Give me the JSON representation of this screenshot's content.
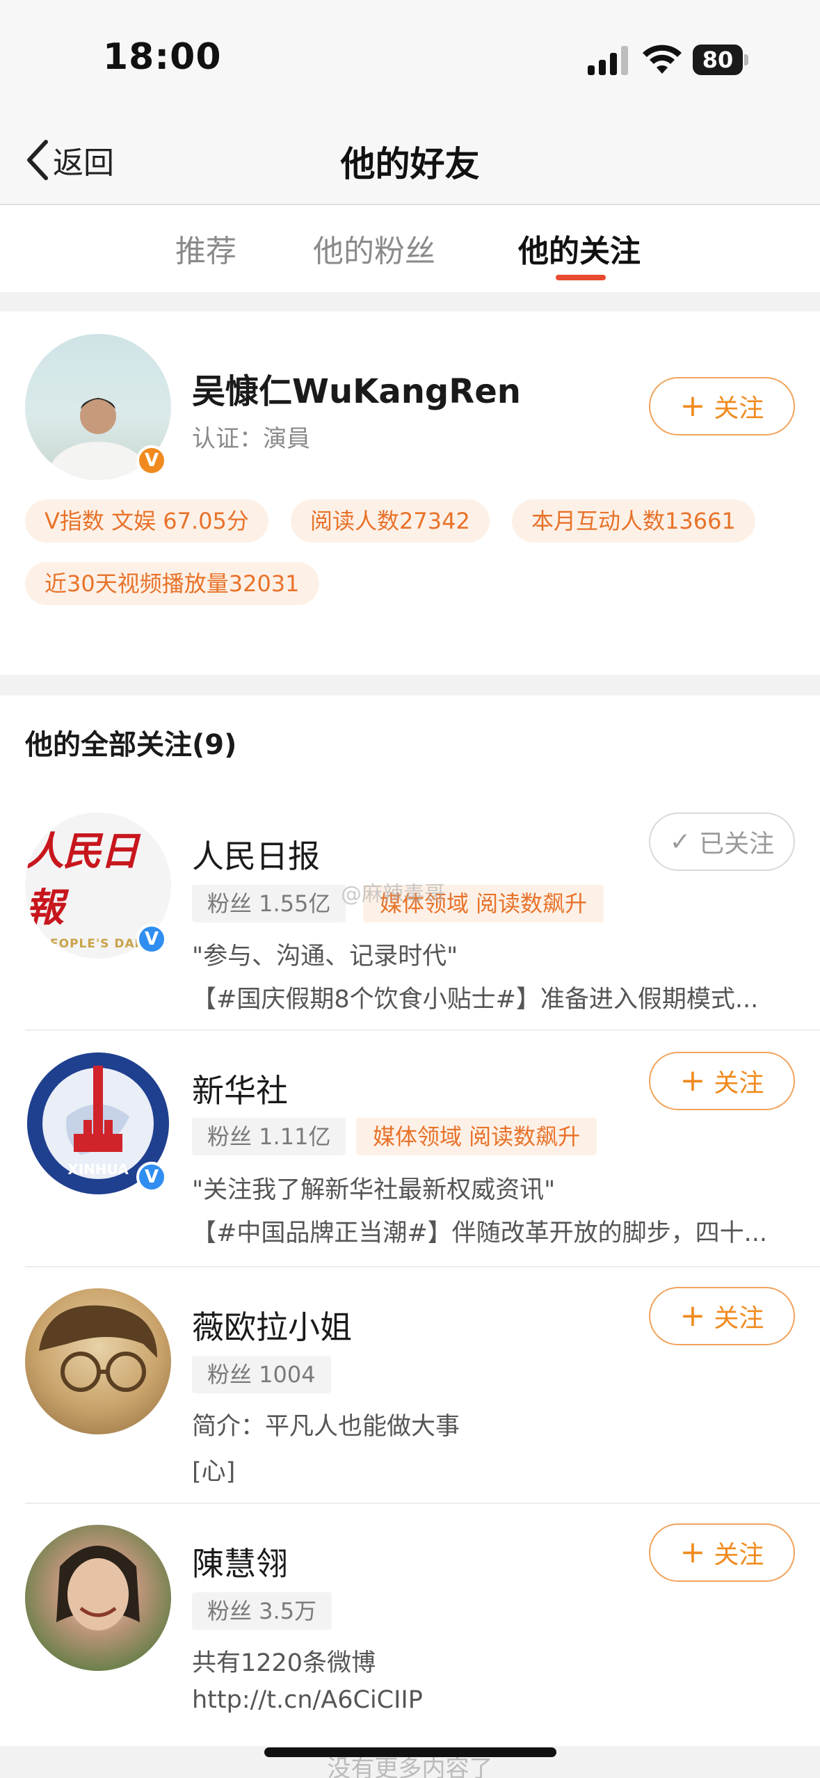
{
  "status_bar": {
    "time": "18:00",
    "battery": "80"
  },
  "nav": {
    "back_label": "返回",
    "title": "他的好友"
  },
  "tabs": [
    {
      "label": "推荐"
    },
    {
      "label": "他的粉丝"
    },
    {
      "label": "他的关注",
      "active": true
    }
  ],
  "profile": {
    "name": "吴慷仁WuKangRen",
    "certification": "认证：演員",
    "follow_label": "关注",
    "badge": "V",
    "chips": [
      "V指数 文娱 67.05分",
      "阅读人数27342",
      "本月互动人数13661",
      "近30天视频播放量32031"
    ]
  },
  "following_section": {
    "title": "他的全部关注(9)"
  },
  "following": [
    {
      "name": "人民日报",
      "fans": "粉丝 1.55亿",
      "tag": "媒体领域 阅读数飙升",
      "line1": "\"参与、沟通、记录时代\"",
      "line2": "【#国庆假期8个饮食小贴士#】准备进入假期模式...",
      "button": "已关注",
      "logo_cn": "人民日報",
      "logo_en": "PEOPLE'S DAILY"
    },
    {
      "name": "新华社",
      "fans": "粉丝 1.11亿",
      "tag": "媒体领域 阅读数飙升",
      "line1": "\"关注我了解新华社最新权威资讯\"",
      "line2": "【#中国品牌正当潮#】伴随改革开放的脚步，四十...",
      "button": "关注",
      "logo_text": "XINHUA"
    },
    {
      "name": "薇欧拉小姐",
      "fans": "粉丝 1004",
      "line1": "简介：平凡人也能做大事",
      "line2": "[心]",
      "button": "关注"
    },
    {
      "name": "陳慧翎",
      "fans": "粉丝 3.5万",
      "line1": "共有1220条微博",
      "line2": "http://t.cn/A6CiCIIP",
      "button": "关注"
    }
  ],
  "footer": {
    "text": "没有更多内容了"
  },
  "watermark": "@麻辣毒哥",
  "colors": {
    "accent": "#f08a1e",
    "tab_underline": "#e84a2f",
    "verified_blue": "#2f8ef0"
  }
}
